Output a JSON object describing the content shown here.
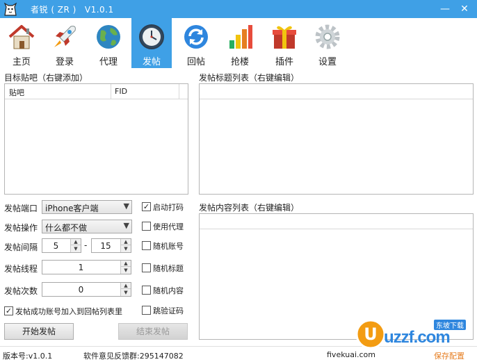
{
  "window": {
    "title": "者锐 ( ZR )",
    "version": "V1.0.1",
    "minimize_glyph": "—",
    "close_glyph": "✕"
  },
  "toolbar": {
    "items": [
      {
        "label": "主页",
        "icon": "house-icon"
      },
      {
        "label": "登录",
        "icon": "rocket-icon"
      },
      {
        "label": "代理",
        "icon": "globe-icon"
      },
      {
        "label": "发帖",
        "icon": "clock-icon",
        "active": true
      },
      {
        "label": "回帖",
        "icon": "refresh-icon"
      },
      {
        "label": "抢楼",
        "icon": "bar-chart-icon"
      },
      {
        "label": "插件",
        "icon": "gift-icon"
      },
      {
        "label": "设置",
        "icon": "gear-icon"
      }
    ],
    "active_color": "#3fa0e6"
  },
  "target_forums": {
    "label": "目标贴吧（右键添加）",
    "columns": [
      "贴吧",
      "FID"
    ]
  },
  "post_titles": {
    "label": "发帖标题列表（右键编辑）"
  },
  "post_contents": {
    "label": "发帖内容列表（右键编辑）"
  },
  "form": {
    "port_label": "发帖端口",
    "port_value": "iPhone客户端",
    "operation_label": "发帖操作",
    "operation_value": "什么都不做",
    "interval_label": "发帖间隔",
    "interval_min": "5",
    "interval_sep": "-",
    "interval_max": "15",
    "threads_label": "发帖线程",
    "threads_value": "1",
    "count_label": "发帖次数",
    "count_value": "0"
  },
  "options": {
    "captcha": {
      "label": "启动打码",
      "checked": true
    },
    "proxy": {
      "label": "使用代理",
      "checked": false
    },
    "random_account": {
      "label": "随机账号",
      "checked": false
    },
    "random_title": {
      "label": "随机标题",
      "checked": false
    },
    "random_content": {
      "label": "随机内容",
      "checked": false
    },
    "skip_captcha": {
      "label": "跳验证码",
      "checked": false
    },
    "add_to_reply": {
      "label": "发帖成功账号加入到回帖列表里",
      "checked": true
    }
  },
  "buttons": {
    "start": "开始发帖",
    "stop": "结束发帖"
  },
  "status": {
    "version": "版本号:v1.0.1",
    "feedback": "软件意见反馈群:295147082",
    "site": "fivekuai.com",
    "save": "保存配置"
  },
  "watermark": {
    "brand": "uzzf.com",
    "tag": "东坡下载"
  },
  "check_glyph": "✓"
}
